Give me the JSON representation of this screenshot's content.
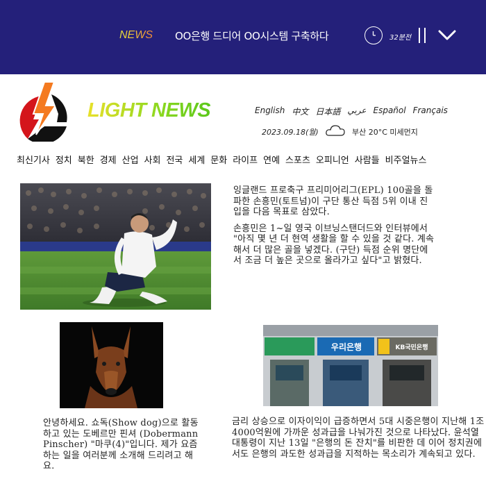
{
  "topbar": {
    "news_label": "NEWS",
    "headline": "OO은행 드디어 OO시스템 구축하다",
    "time_ago": "32분전",
    "background": "#24207a"
  },
  "masthead": {
    "logo_text": "LIGHT NEWS",
    "languages": [
      "English",
      "中文",
      "日本語",
      "عربي",
      "Español",
      "Français"
    ],
    "date": "2023.09.18(월)",
    "weather": "부산 20°C 미세먼지"
  },
  "nav": {
    "categories": [
      "최신기사",
      "정치",
      "북한",
      "경제",
      "산업",
      "사회",
      "전국",
      "세계",
      "문화",
      "라이프",
      "연예",
      "스포츠",
      "오피니언",
      "사람들",
      "비주얼뉴스"
    ]
  },
  "articles": {
    "sports": {
      "paragraph1": "잉글랜드 프로축구 프리미어리그(EPL) 100골을 돌파한 손흥민(토트넘)이 구단 통산 득점 5위 이내 진입을 다음 목표로 삼았다.",
      "paragraph2": "손흥민은 1~일 영국 이브닝스탠더드와 인터뷰에서 \"아직 몇 년 더 현역 생활을 할 수 있을 것 같다. 계속해서 더 많은 골을 넣겠다. (구단) 득점 순위 명단에서 조금 더 높은 곳으로 올라가고 싶다\"고 밝혔다."
    },
    "dog": {
      "text": "안녕하세요. 쇼독(Show dog)으로 활동하고 있는 도베르만 핀셔 (Dobermann Pinscher) \"마쿠(4)\"입니다. 제가 요즘 하는 일을 여러분께 소개해 드리려고 해요."
    },
    "bank": {
      "text": "금리 상승으로 이자이익이 급증하면서 5대 시중은행이 지난해 1조4000억원에 가까운 성과급을 나눠가진 것으로 나타났다. 윤석열 대통령이 지난 13일 \"은행의 돈 잔치\"를 비판한 데 이어 정치권에서도 은행의 과도한 성과급을 지적하는 목소리가 계속되고 있다.",
      "signs": [
        "우리은행",
        "KB국민은행"
      ]
    }
  }
}
